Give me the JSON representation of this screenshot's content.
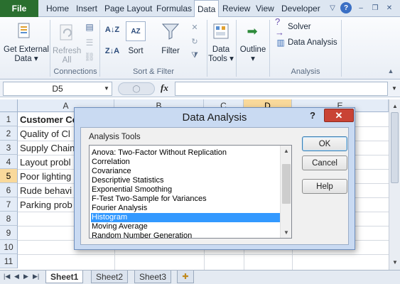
{
  "ribbon": {
    "tabs": [
      {
        "label": "File"
      },
      {
        "label": "Home"
      },
      {
        "label": "Insert"
      },
      {
        "label": "Page Layout"
      },
      {
        "label": "Formulas"
      },
      {
        "label": "Data"
      },
      {
        "label": "Review"
      },
      {
        "label": "View"
      },
      {
        "label": "Developer"
      }
    ],
    "active_tab": "Data",
    "buttons": {
      "get_external_data": "Get External Data",
      "refresh_all": "Refresh All",
      "sort": "Sort",
      "filter": "Filter",
      "data_tools": "Data Tools",
      "outline": "Outline",
      "solver": "Solver",
      "data_analysis": "Data Analysis"
    },
    "groups": {
      "connections": "Connections",
      "sort_filter": "Sort & Filter",
      "analysis": "Analysis"
    }
  },
  "formula_bar": {
    "name_box": "D5",
    "fx_label": "fx",
    "formula": ""
  },
  "sheet": {
    "columns": [
      "A",
      "B",
      "C",
      "D",
      "E"
    ],
    "selected_column": "D",
    "rows": [
      {
        "number": "1",
        "a": "Customer Co"
      },
      {
        "number": "2",
        "a": "Quality of Cl"
      },
      {
        "number": "3",
        "a": "Supply Chain"
      },
      {
        "number": "4",
        "a": "Layout probl"
      },
      {
        "number": "5",
        "a": "Poor lighting"
      },
      {
        "number": "6",
        "a": "Rude behavi"
      },
      {
        "number": "7",
        "a": "Parking prob"
      },
      {
        "number": "8",
        "a": ""
      },
      {
        "number": "9",
        "a": ""
      },
      {
        "number": "10",
        "a": ""
      },
      {
        "number": "11",
        "a": ""
      }
    ],
    "selected_row": "5",
    "tabs": [
      {
        "label": "Sheet1"
      },
      {
        "label": "Sheet2"
      },
      {
        "label": "Sheet3"
      }
    ],
    "active_tab": "Sheet1"
  },
  "dialog": {
    "title": "Data Analysis",
    "help_glyph": "?",
    "close_glyph": "✕",
    "list_label": "Analysis Tools",
    "tools": [
      "Anova: Two-Factor Without Replication",
      "Correlation",
      "Covariance",
      "Descriptive Statistics",
      "Exponential Smoothing",
      "F-Test Two-Sample for Variances",
      "Fourier Analysis",
      "Histogram",
      "Moving Average",
      "Random Number Generation"
    ],
    "selected_tool": "Histogram",
    "ok_label": "OK",
    "cancel_label": "Cancel",
    "help_label": "Help"
  },
  "colors": {
    "file_tab": "#2a6f2f",
    "selection": "#3399ff",
    "close_button": "#c94335",
    "header_highlight": "#f9d99b"
  }
}
